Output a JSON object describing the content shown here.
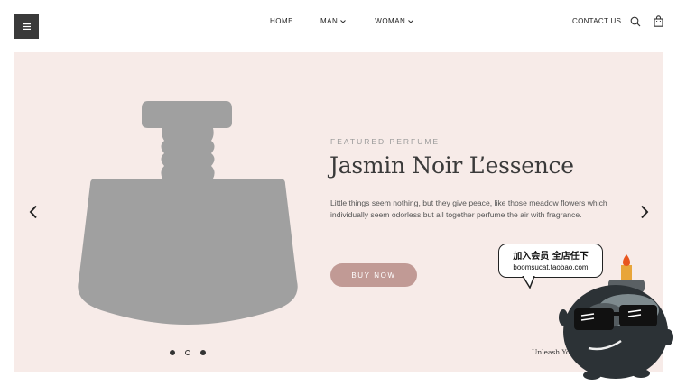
{
  "header": {
    "menu_icon": "hamburger-icon",
    "nav": [
      {
        "label": "HOME",
        "has_dropdown": false
      },
      {
        "label": "MAN",
        "has_dropdown": true
      },
      {
        "label": "WOMAN",
        "has_dropdown": true
      }
    ],
    "contact_label": "CONTACT US",
    "search_icon": "search-icon",
    "cart_icon": "shopping-bag-icon"
  },
  "hero": {
    "eyebrow": "FEATURED PERFUME",
    "title": "Jasmin Noir L’essence",
    "description": "Little things seem nothing, but they give peace, like those meadow flowers which individually seem odorless but all together perfume the air with fragrance.",
    "cta_label": "BUY NOW",
    "tagline": "Unleash Your",
    "background_color": "#f7ebe8",
    "cta_color": "#c19a95",
    "slides": {
      "count": 3,
      "active_index": 1
    }
  },
  "overlay": {
    "bubble_line1": "加入会员 全店任下",
    "bubble_line2": "boomsucat.taobao.com"
  }
}
